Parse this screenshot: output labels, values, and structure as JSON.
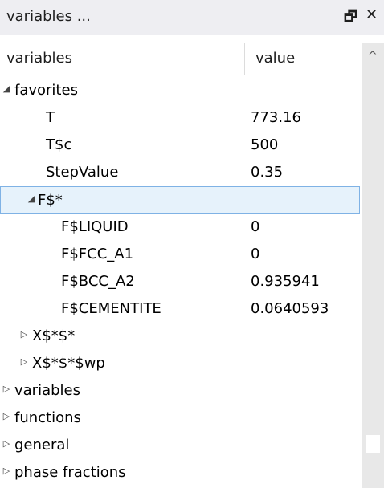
{
  "window": {
    "title": "variables ...",
    "restore_icon": "restore-icon",
    "close_icon": "close-icon"
  },
  "columns": {
    "name": "variables",
    "value": "value"
  },
  "tree": {
    "favorites": {
      "label": "favorites",
      "expanded": true
    },
    "T": {
      "label": "T",
      "value": "773.16"
    },
    "Tc": {
      "label": "T$c",
      "value": "500"
    },
    "StepValue": {
      "label": "StepValue",
      "value": "0.35"
    },
    "Fstar": {
      "label": "F$*",
      "expanded": true,
      "selected": true
    },
    "FLIQUID": {
      "label": "F$LIQUID",
      "value": "0"
    },
    "FFCC": {
      "label": "F$FCC_A1",
      "value": "0"
    },
    "FBCC": {
      "label": "F$BCC_A2",
      "value": "0.935941"
    },
    "FCEM": {
      "label": "F$CEMENTITE",
      "value": "0.0640593"
    },
    "X1": {
      "label": "X$*$*",
      "expanded": false
    },
    "X2": {
      "label": "X$*$*$wp",
      "expanded": false
    },
    "variables": {
      "label": "variables",
      "expanded": false
    },
    "functions": {
      "label": "functions",
      "expanded": false
    },
    "general": {
      "label": "general",
      "expanded": false
    },
    "phase_fractions": {
      "label": "phase fractions",
      "expanded": false
    }
  },
  "glyphs": {
    "expanded": "◢",
    "collapsed": "▷",
    "scroll_up": "^",
    "restore": "🗗",
    "close": "✕"
  }
}
